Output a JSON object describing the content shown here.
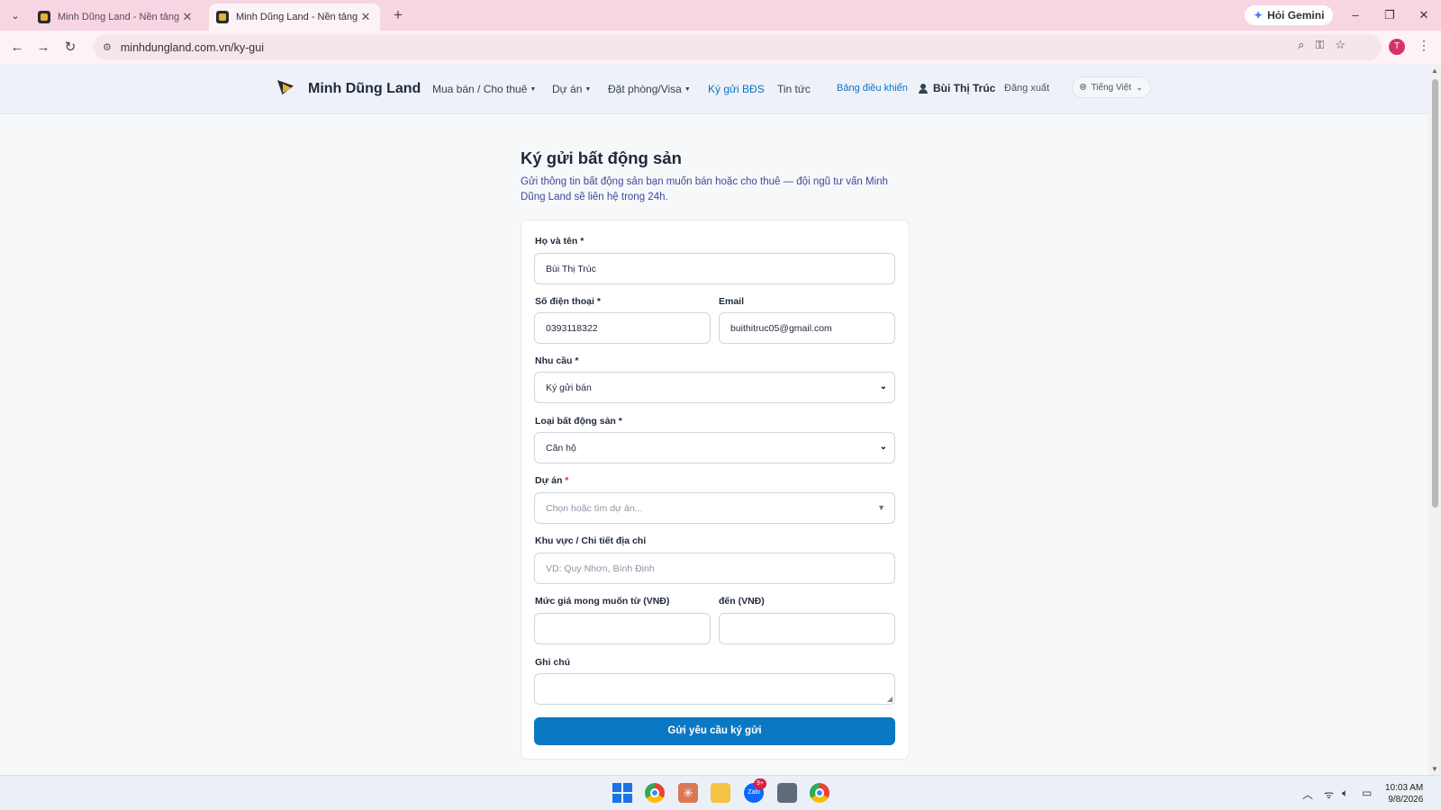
{
  "browser": {
    "tabs": [
      {
        "title": "Minh Dũng Land - Nền tảng bấ",
        "active": false
      },
      {
        "title": "Minh Dũng Land - Nền tảng bấ",
        "active": true
      }
    ],
    "gemini_label": "Hỏi Gemini",
    "url": "minhdungland.com.vn/ky-gui",
    "profile_initial": "T"
  },
  "header": {
    "brand": "Minh Dũng Land",
    "nav": [
      {
        "label": "Mua bán / Cho thuê",
        "dropdown": true
      },
      {
        "label": "Dự án",
        "dropdown": true
      },
      {
        "label": "Đặt phòng/Visa",
        "dropdown": true
      },
      {
        "label": "Ký gửi BĐS",
        "dropdown": false,
        "active": true
      },
      {
        "label": "Tin tức",
        "dropdown": false
      }
    ],
    "dashboard": "Bảng điều khiển",
    "user": "Bùi Thị Trúc",
    "logout": "Đăng xuất",
    "language": "Tiếng Việt"
  },
  "page": {
    "title": "Ký gửi bất động sản",
    "subtitle": "Gửi thông tin bất động sản bạn muốn bán hoặc cho thuê — đội ngũ tư vấn Minh Dũng Land sẽ liên hệ trong 24h."
  },
  "form": {
    "fullname": {
      "label": "Họ và tên",
      "value": "Bùi Thị Trúc"
    },
    "phone": {
      "label": "Số điện thoại",
      "value": "0393118322"
    },
    "email": {
      "label": "Email",
      "value": "buithitruc05@gmail.com"
    },
    "need": {
      "label": "Nhu cầu",
      "value": "Ký gửi bán"
    },
    "property_type": {
      "label": "Loại bất động sản",
      "value": "Căn hộ"
    },
    "project": {
      "label": "Dự án",
      "placeholder": "Chọn hoặc tìm dự án..."
    },
    "address": {
      "label": "Khu vực / Chi tiết địa chỉ",
      "placeholder": "VD: Quy Nhơn, Bình Định"
    },
    "price_from": {
      "label": "Mức giá mong muốn từ (VNĐ)",
      "value": ""
    },
    "price_to": {
      "label": "đến (VNĐ)",
      "value": ""
    },
    "note": {
      "label": "Ghi chú",
      "value": ""
    },
    "submit": "Gửi yêu cầu ký gửi",
    "required_mark": "*"
  },
  "taskbar": {
    "zalo_badge": "9+",
    "time": "10:03 AM",
    "date": "9/8/2026"
  },
  "colors": {
    "accent": "#0a78c2",
    "tabstrip": "#f7d5e3",
    "required_red": "#dc2626"
  }
}
